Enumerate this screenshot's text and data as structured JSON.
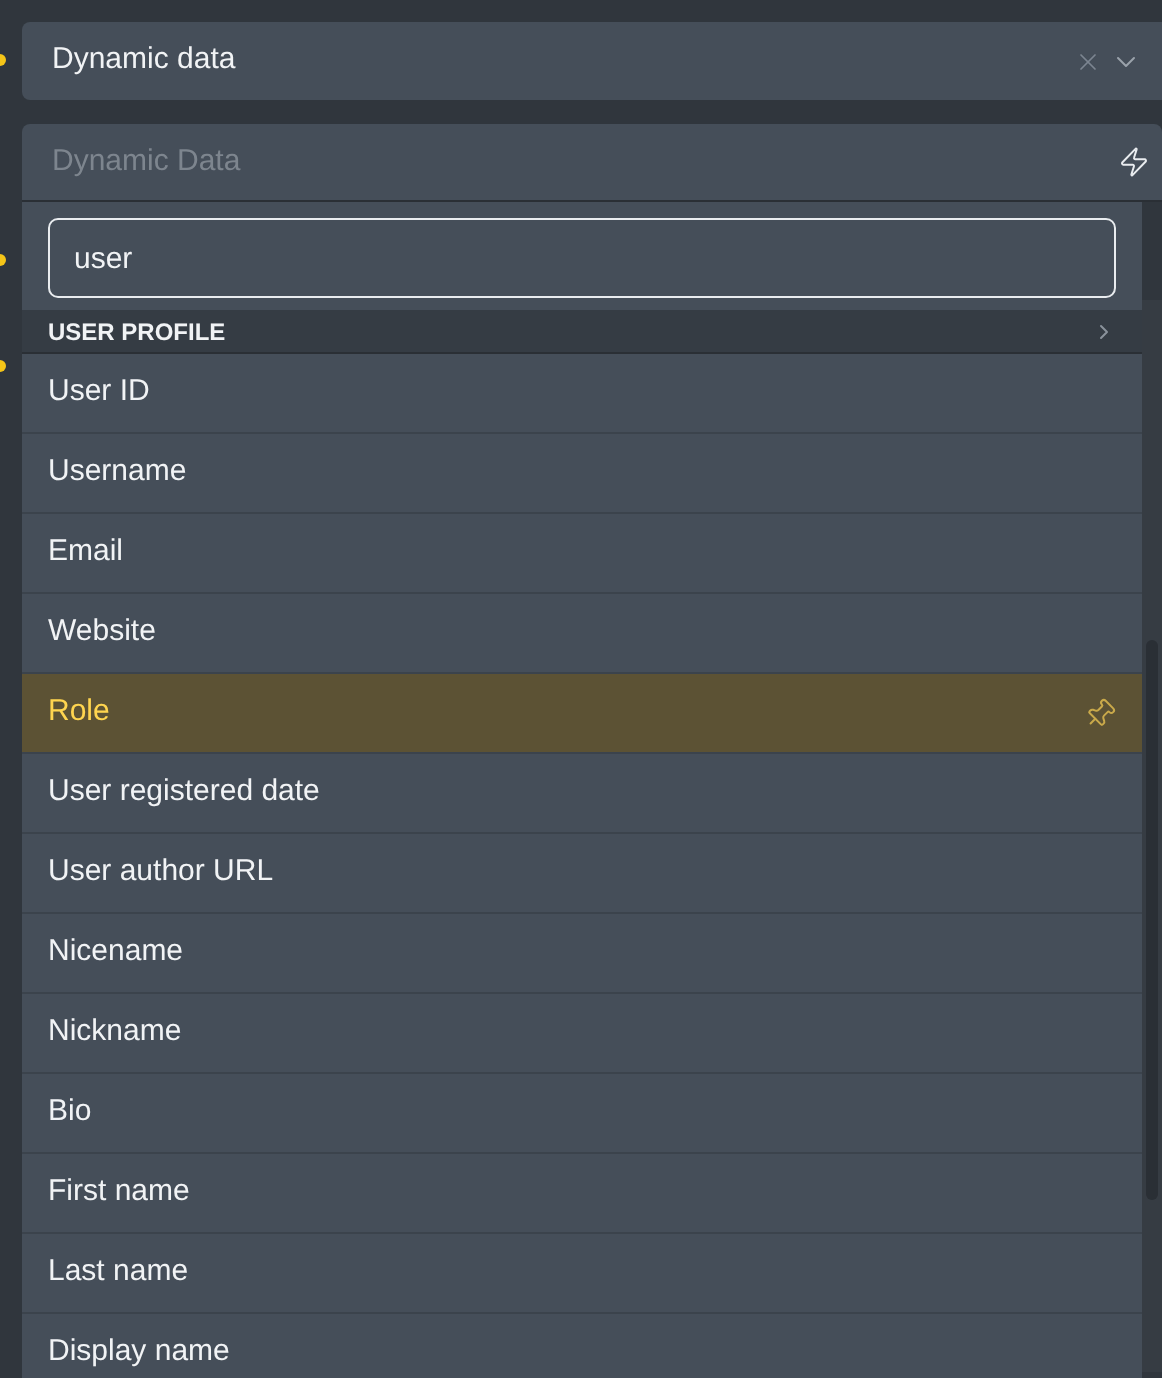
{
  "select": {
    "value": "Dynamic data"
  },
  "dynamic_field": {
    "placeholder": "Dynamic Data"
  },
  "search": {
    "value": "user"
  },
  "group": {
    "label": "USER PROFILE"
  },
  "items": [
    {
      "label": "User ID",
      "selected": false
    },
    {
      "label": "Username",
      "selected": false
    },
    {
      "label": "Email",
      "selected": false
    },
    {
      "label": "Website",
      "selected": false
    },
    {
      "label": "Role",
      "selected": true
    },
    {
      "label": "User registered date",
      "selected": false
    },
    {
      "label": "User author URL",
      "selected": false
    },
    {
      "label": "Nicename",
      "selected": false
    },
    {
      "label": "Nickname",
      "selected": false
    },
    {
      "label": "Bio",
      "selected": false
    },
    {
      "label": "First name",
      "selected": false
    },
    {
      "label": "Last name",
      "selected": false
    },
    {
      "label": "Display name",
      "selected": false
    }
  ]
}
